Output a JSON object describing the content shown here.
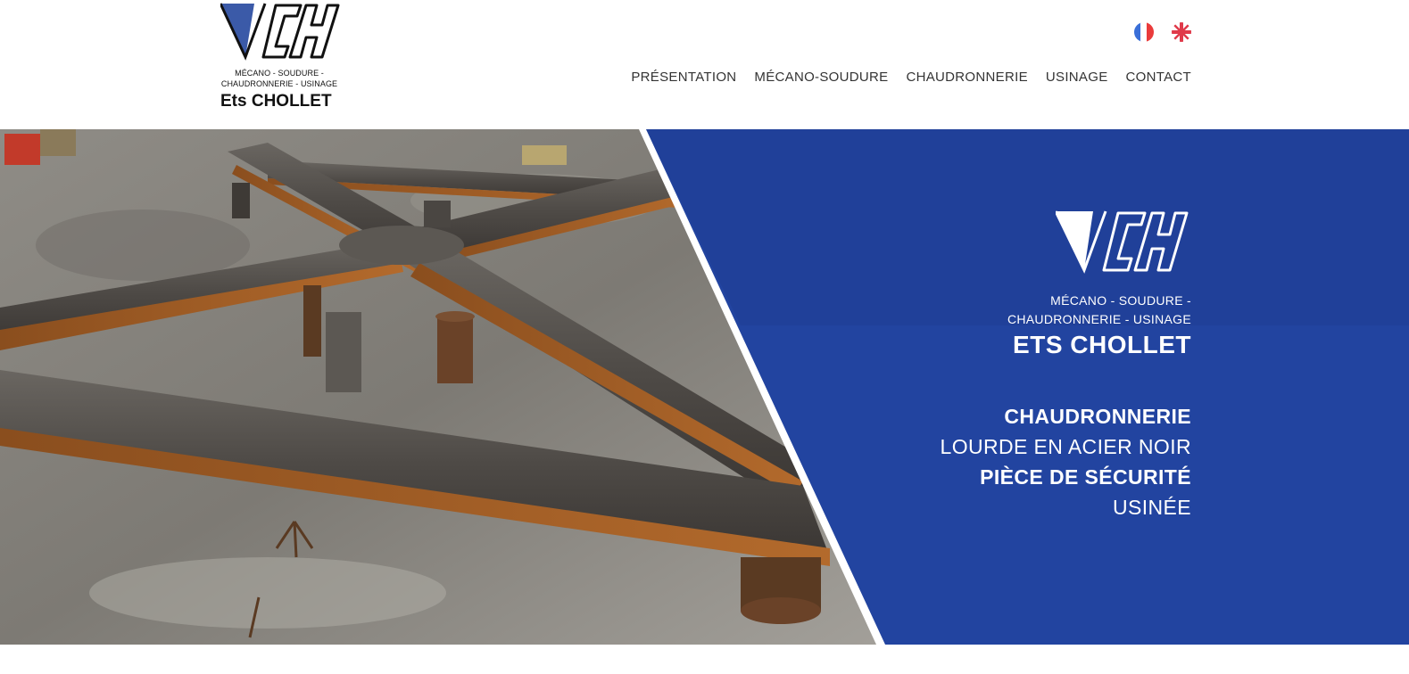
{
  "header": {
    "logo_alt": "CH",
    "logo_tagline_line1": "MÉCANO - SOUDURE -",
    "logo_tagline_line2": "CHAUDRONNERIE - USINAGE",
    "company_name": "Ets CHOLLET",
    "languages": [
      {
        "code": "fr",
        "icon": "french-flag-icon"
      },
      {
        "code": "en",
        "icon": "uk-flag-icon"
      }
    ],
    "nav": [
      {
        "label": "PRÉSENTATION"
      },
      {
        "label": "MÉCANO-SOUDURE"
      },
      {
        "label": "CHAUDRONNERIE"
      },
      {
        "label": "USINAGE"
      },
      {
        "label": "CONTACT"
      }
    ]
  },
  "hero": {
    "tagline_line1": "MÉCANO - SOUDURE -",
    "tagline_line2": "CHAUDRONNERIE - USINAGE",
    "company_name": "ETS CHOLLET",
    "line1": "CHAUDRONNERIE",
    "line2": "LOURDE EN ACIER NOIR",
    "line3": "PIÈCE DE SÉCURITÉ",
    "line4": "USINÉE"
  },
  "colors": {
    "brand_blue": "#2244a0",
    "logo_blue_triangle": "#3b5aa8",
    "text_dark": "#111111"
  }
}
